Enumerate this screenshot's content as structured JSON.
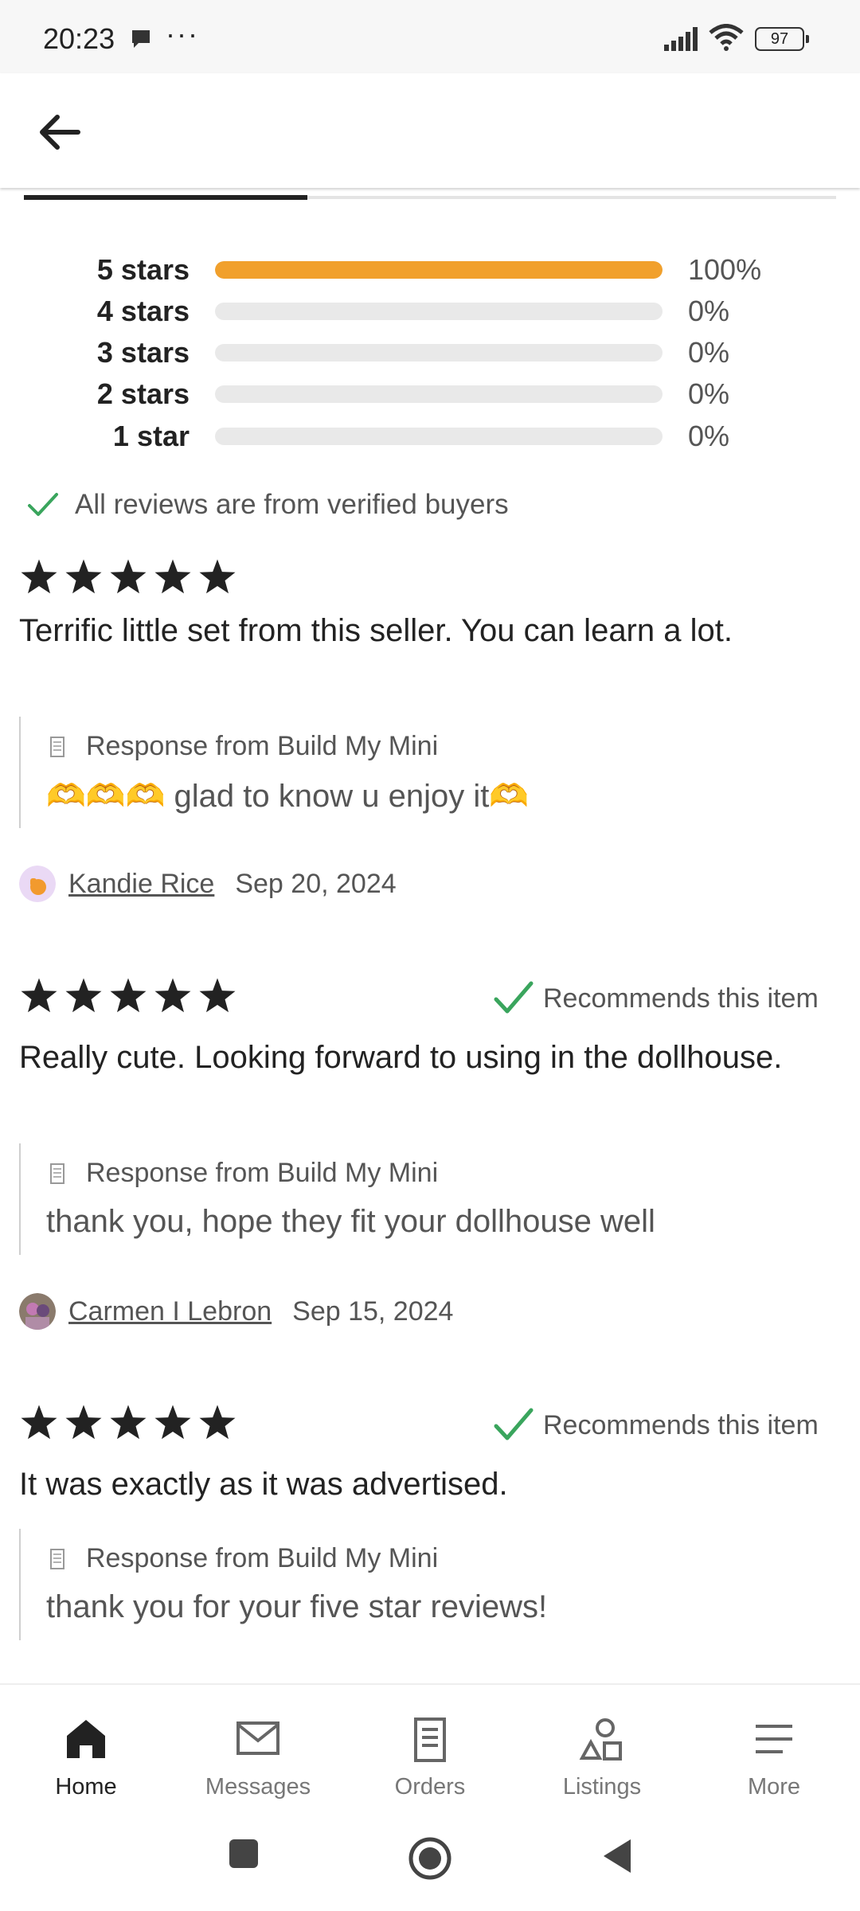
{
  "status_bar": {
    "time": "20:23",
    "dots": "···",
    "battery": "97"
  },
  "histogram": [
    {
      "label": "5 stars",
      "fraction": 1.0,
      "percent": "100%"
    },
    {
      "label": "4 stars",
      "fraction": 0.0,
      "percent": "0%"
    },
    {
      "label": "3 stars",
      "fraction": 0.0,
      "percent": "0%"
    },
    {
      "label": "2 stars",
      "fraction": 0.0,
      "percent": "0%"
    },
    {
      "label": "1 star",
      "fraction": 0.0,
      "percent": "0%"
    }
  ],
  "accent_color": "#f1a02c",
  "verified_text": "All reviews are from verified buyers",
  "reviews": [
    {
      "rating": 5,
      "recommends": "",
      "text": "Terrific little set from this seller. You can learn a lot.",
      "response_label": "Response from Build My Mini",
      "response_text": "🫶🫶🫶 glad to know u enjoy it🫶",
      "author": "Kandie Rice",
      "date": "Sep 20, 2024"
    },
    {
      "rating": 5,
      "recommends": "Recommends this item",
      "text": "Really cute. Looking forward to using in the dollhouse.",
      "response_label": "Response from Build My Mini",
      "response_text": "thank you, hope they fit your dollhouse well",
      "author": "Carmen I Lebron",
      "date": "Sep 15, 2024"
    },
    {
      "rating": 5,
      "recommends": "Recommends this item",
      "text": "It was exactly as it was advertised.",
      "response_label": "Response from Build My Mini",
      "response_text": "thank you for your five star reviews!"
    }
  ],
  "bottom_nav": [
    {
      "label": "Home",
      "icon": "home-icon",
      "active": true
    },
    {
      "label": "Messages",
      "icon": "envelope-icon",
      "active": false
    },
    {
      "label": "Orders",
      "icon": "document-icon",
      "active": false
    },
    {
      "label": "Listings",
      "icon": "shapes-icon",
      "active": false
    },
    {
      "label": "More",
      "icon": "menu-icon",
      "active": false
    }
  ]
}
